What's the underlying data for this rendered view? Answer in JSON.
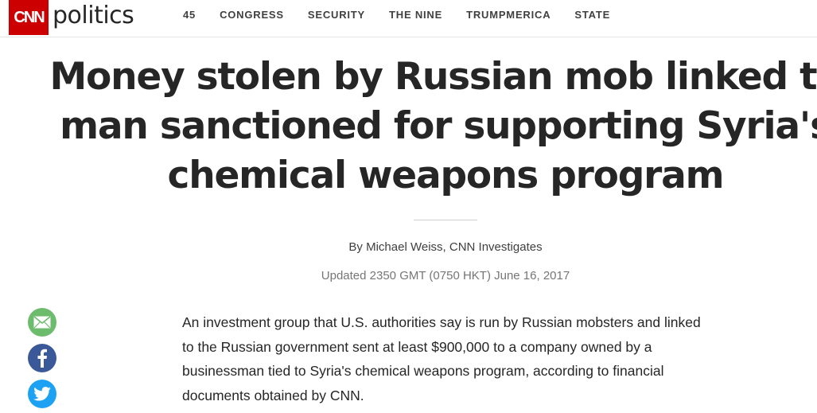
{
  "header": {
    "brand": "CNN",
    "section": "politics",
    "nav": [
      "45",
      "CONGRESS",
      "SECURITY",
      "THE NINE",
      "TRUMPMERICA",
      "STATE"
    ]
  },
  "article": {
    "headline_lines": [
      "Money stolen by Russian mob linked to",
      "man sanctioned for supporting Syria's",
      "chemical weapons program"
    ],
    "byline_prefix": "By ",
    "author": "Michael Weiss",
    "byline_suffix": ", CNN Investigates",
    "updated": "Updated 2350 GMT (0750 HKT) June 16, 2017",
    "paragraph": "An investment group that U.S. authorities say is run by Russian mobsters and linked to the Russian government sent at least $900,000 to a company owned by a businessman tied to Syria's chemical weapons program, according to financial documents obtained by CNN."
  },
  "share": {
    "icons": [
      "email-icon",
      "facebook-icon",
      "twitter-icon"
    ]
  },
  "colors": {
    "brand_red": "#cc0000",
    "email_green": "#6dbb6d",
    "facebook_blue": "#3b5998",
    "twitter_blue": "#1da1f2"
  }
}
